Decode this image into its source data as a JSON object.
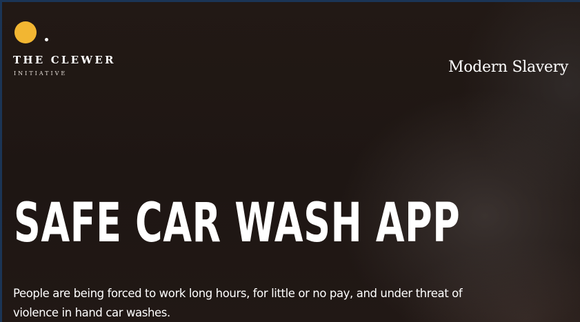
{
  "logo": {
    "name": "THE CLEWER",
    "sub": "INITIATIVE",
    "dot_color": "#f2b632"
  },
  "nav": {
    "link_label": "Modern Slavery"
  },
  "hero": {
    "title": "SAFE CAR WASH APP",
    "intro": "People are being forced to work long hours, for little or no pay, and under threat of violence in hand car washes."
  }
}
